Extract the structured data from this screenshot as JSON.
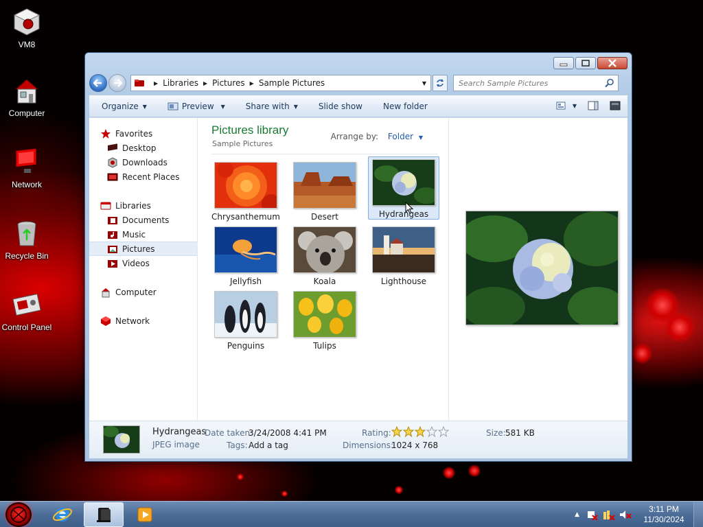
{
  "desktop": {
    "icons": [
      {
        "label": "VM8",
        "icon": "vm-cube-icon"
      },
      {
        "label": "Computer",
        "icon": "computer-icon"
      },
      {
        "label": "Network",
        "icon": "network-icon"
      },
      {
        "label": "Recycle Bin",
        "icon": "recycle-bin-icon"
      },
      {
        "label": "Control Panel",
        "icon": "control-panel-icon"
      }
    ]
  },
  "window": {
    "breadcrumbs": [
      "Libraries",
      "Pictures",
      "Sample Pictures"
    ],
    "search_placeholder": "Search Sample Pictures",
    "toolbar": {
      "organize": "Organize",
      "preview": "Preview",
      "share_with": "Share with",
      "slide_show": "Slide show",
      "new_folder": "New folder"
    },
    "nav": {
      "favorites": "Favorites",
      "favorites_items": [
        "Desktop",
        "Downloads",
        "Recent Places"
      ],
      "libraries": "Libraries",
      "libraries_items": [
        "Documents",
        "Music",
        "Pictures",
        "Videos"
      ],
      "selected": "Pictures",
      "computer": "Computer",
      "network": "Network"
    },
    "library": {
      "title": "Pictures library",
      "subtitle": "Sample Pictures",
      "arrange_label": "Arrange by:",
      "arrange_value": "Folder"
    },
    "files": [
      "Chrysanthemum",
      "Desert",
      "Hydrangeas",
      "Jellyfish",
      "Koala",
      "Lighthouse",
      "Penguins",
      "Tulips"
    ],
    "selected_file": "Hydrangeas",
    "details": {
      "name": "Hydrangeas",
      "type": "JPEG image",
      "date_taken_label": "Date taken:",
      "date_taken": "3/24/2008 4:41 PM",
      "tags_label": "Tags:",
      "tags_value": "Add a tag",
      "rating_label": "Rating:",
      "rating": 3,
      "rating_max": 5,
      "dimensions_label": "Dimensions:",
      "dimensions": "1024 x 768",
      "size_label": "Size:",
      "size": "581 KB"
    }
  },
  "taskbar": {
    "time": "3:11 PM",
    "date": "11/30/2024"
  },
  "colors": {
    "library_title": "#1a7a33",
    "link_blue": "#1f5ea8",
    "wallpaper_red": "#d00000"
  }
}
